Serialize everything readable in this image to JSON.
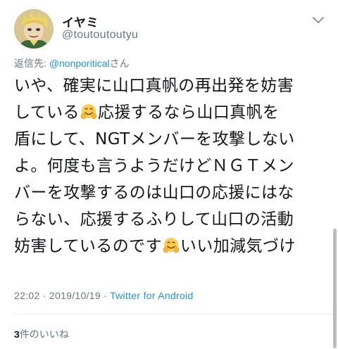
{
  "header": {
    "display_name": "イヤミ",
    "handle": "@toutoutoutyu",
    "avatar_icon": "avatar-image",
    "more_icon": "chevron-down-icon"
  },
  "reply": {
    "prefix": "返信先: ",
    "mention": "@nonporitical",
    "suffix": "さん"
  },
  "tweet_lines": [
    {
      "text": "いや、確実に山口真帆の再出発を妨害"
    },
    {
      "before": "している",
      "emoji": "hugging-face-emoji",
      "after": "応援するなら山口真帆を"
    },
    {
      "text": "盾にして、NGTメンバーを攻撃しない"
    },
    {
      "text": "よ。何度も言うようだけどＮＧＴメン"
    },
    {
      "text": "バーを攻撃するのは山口の応援にはな"
    },
    {
      "text": "らない、応援するふりして山口の活動"
    },
    {
      "before": "妨害しているのです",
      "emoji": "hugging-face-emoji",
      "after": "いい加減気づけ"
    }
  ],
  "meta": {
    "time": "22:02",
    "date": "2019/10/19",
    "separator": " · ",
    "source": "Twitter for Android"
  },
  "likes": {
    "count": "3",
    "label": "件のいいね"
  },
  "colors": {
    "link": "#1b95e0",
    "secondary": "#657786",
    "text": "#14171a",
    "divider": "#e6ecf0"
  }
}
